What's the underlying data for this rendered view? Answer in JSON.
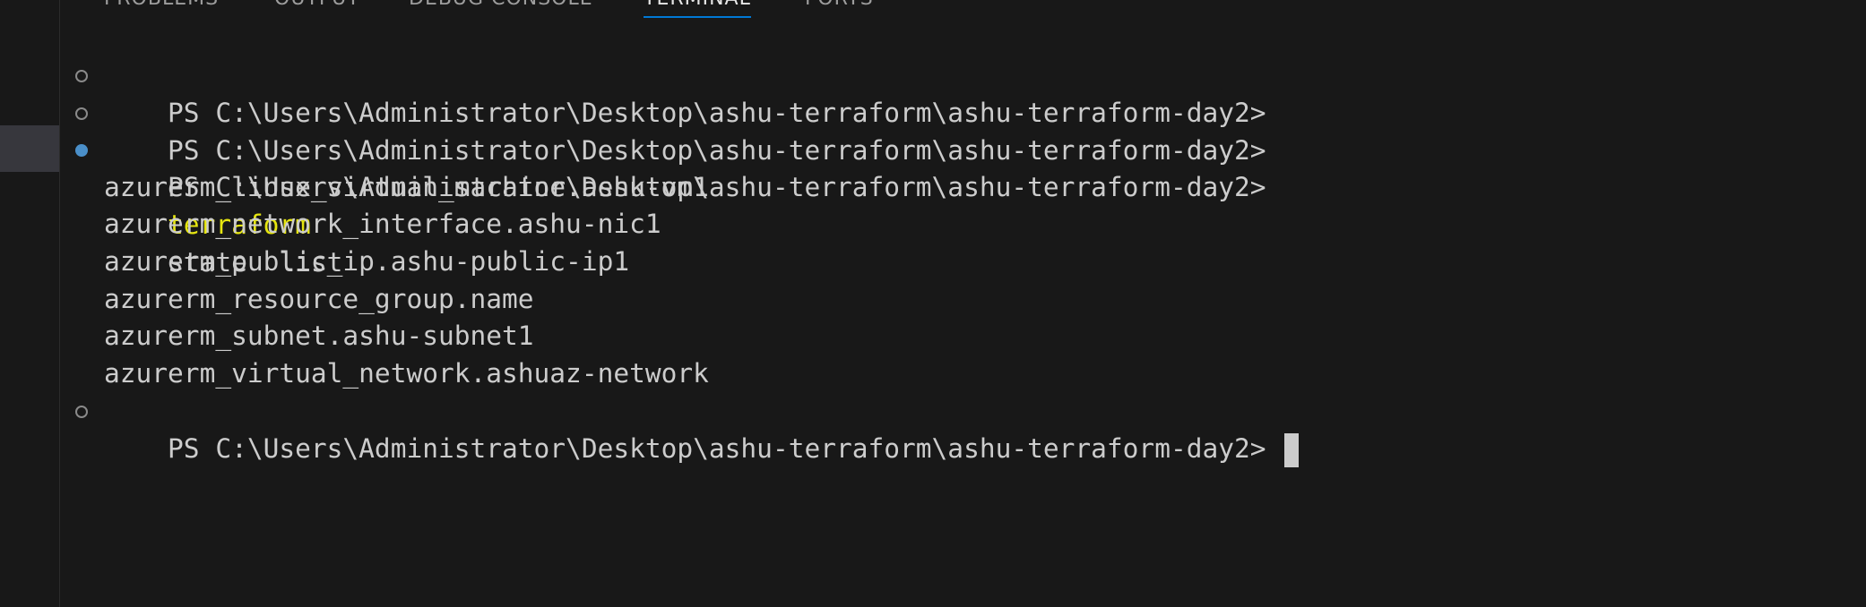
{
  "panel": {
    "tabs": [
      {
        "label": "PROBLEMS"
      },
      {
        "label": "OUTPUT"
      },
      {
        "label": "DEBUG CONSOLE"
      },
      {
        "label": "TERMINAL"
      },
      {
        "label": "PORTS"
      }
    ],
    "active_tab": "TERMINAL"
  },
  "terminal": {
    "lines": [
      {
        "prompt": "PS C:\\Users\\Administrator\\Desktop\\ashu-terraform\\ashu-terraform-day2>",
        "command": "",
        "decoration": "default"
      },
      {
        "prompt": "PS C:\\Users\\Administrator\\Desktop\\ashu-terraform\\ashu-terraform-day2>",
        "command": "",
        "decoration": "default"
      },
      {
        "prompt": "PS C:\\Users\\Administrator\\Desktop\\ashu-terraform\\ashu-terraform-day2>",
        "command": "terraform",
        "args": "state  list",
        "decoration": "success"
      }
    ],
    "output": [
      "azurerm_linux_virtual_machine.ashu-vm1",
      "azurerm_network_interface.ashu-nic1",
      "azurerm_public_ip.ashu-public-ip1",
      "azurerm_resource_group.name",
      "azurerm_subnet.ashu-subnet1",
      "azurerm_virtual_network.ashuaz-network"
    ],
    "current_prompt": "PS C:\\Users\\Administrator\\Desktop\\ashu-terraform\\ashu-terraform-day2>",
    "colors": {
      "background": "#181818",
      "foreground": "#cccccc",
      "command": "#e5e510",
      "success_decoration": "#4a8fc9",
      "active_tab_underline": "#0078d4"
    }
  }
}
